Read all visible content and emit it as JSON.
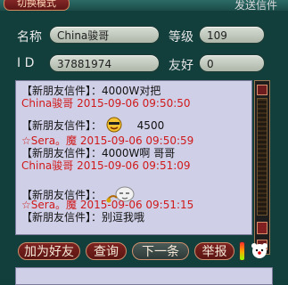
{
  "window": {
    "mode_tab": "切换模式",
    "title": "发送信件"
  },
  "profile": {
    "name_label": "名称",
    "name_value": "China骏哥",
    "level_label": "等级",
    "level_value": "109",
    "id_label": "I  D",
    "id_value": "37881974",
    "friend_label": "友好",
    "friend_value": "0"
  },
  "chat": {
    "lines": [
      {
        "text": "【新朋友信件】：4000W对把",
        "style": "sys"
      },
      {
        "text": "China骏哥 2015-09-06 09:50:50",
        "style": "red"
      },
      {
        "text": "【新朋友信件】：",
        "style": "sys",
        "tail": "4500",
        "icon": "happy-emoji-icon"
      },
      {
        "text": "☆Sera。魔 2015-09-06 09:50:59",
        "style": "red"
      },
      {
        "text": "【新朋友信件】：4000W啊 哥哥",
        "style": "sys"
      },
      {
        "text": "China骏哥 2015-09-06 09:51:09",
        "style": "red"
      },
      {
        "text": "【新朋友信件】：",
        "style": "sys",
        "icon": "sleepy-emoji-icon"
      },
      {
        "text": "☆Sera。魔 2015-09-06 09:51:15",
        "style": "red"
      },
      {
        "text": "【新朋友信件】：别逗我哦",
        "style": "sys"
      }
    ]
  },
  "buttons": {
    "add_friend": "加为好友",
    "query": "查询",
    "next": "下一条",
    "report": "举报"
  },
  "colors": {
    "panel_bg": "#123f3c",
    "chat_bg": "#cfd0e8",
    "accent_red": "#d0191a"
  }
}
